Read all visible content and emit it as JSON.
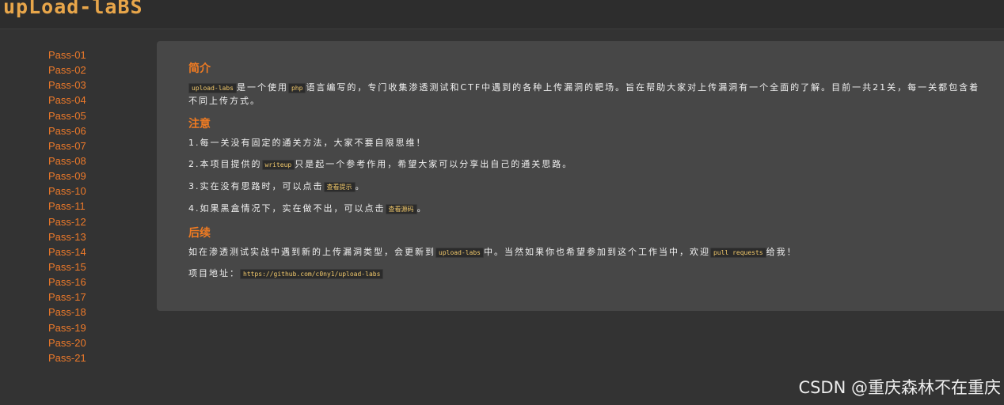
{
  "header": {
    "logo_text": "upLoad-laBS"
  },
  "sidebar": {
    "items": [
      {
        "label": "Pass-01"
      },
      {
        "label": "Pass-02"
      },
      {
        "label": "Pass-03"
      },
      {
        "label": "Pass-04"
      },
      {
        "label": "Pass-05"
      },
      {
        "label": "Pass-06"
      },
      {
        "label": "Pass-07"
      },
      {
        "label": "Pass-08"
      },
      {
        "label": "Pass-09"
      },
      {
        "label": "Pass-10"
      },
      {
        "label": "Pass-11"
      },
      {
        "label": "Pass-12"
      },
      {
        "label": "Pass-13"
      },
      {
        "label": "Pass-14"
      },
      {
        "label": "Pass-15"
      },
      {
        "label": "Pass-16"
      },
      {
        "label": "Pass-17"
      },
      {
        "label": "Pass-18"
      },
      {
        "label": "Pass-19"
      },
      {
        "label": "Pass-20"
      },
      {
        "label": "Pass-21"
      }
    ]
  },
  "intro": {
    "heading": "简介",
    "code_name": "upload-labs",
    "text_a": "是一个使用",
    "code_lang": "php",
    "text_b": "语言编写的，专门收集渗透测试和CTF中遇到的各种上传漏洞的靶场。旨在帮助大家对上传漏洞有一个全面的了解。目前一共21关，每一关都包含着不同上传方式。"
  },
  "notice": {
    "heading": "注意",
    "item1": "1.每一关没有固定的通关方法，大家不要自限思维！",
    "item2_a": "2.本项目提供的",
    "item2_code": "writeup",
    "item2_b": "只是起一个参考作用，希望大家可以分享出自己的通关思路。",
    "item3_a": "3.实在没有思路时，可以点击",
    "item3_code": "查看提示",
    "item3_b": "。",
    "item4_a": "4.如果黑盒情况下，实在做不出，可以点击",
    "item4_code": "查看源码",
    "item4_b": "。"
  },
  "followup": {
    "heading": "后续",
    "text_a": "如在渗透测试实战中遇到新的上传漏洞类型，会更新到",
    "code_name": "upload-labs",
    "text_b": "中。当然如果你也希望参加到这个工作当中，欢迎",
    "code_pr": "pull requests",
    "text_c": "给我！",
    "addr_label": "项目地址：",
    "addr_url": "https://github.com/c0ny1/upload-labs"
  },
  "watermark": "CSDN @重庆森林不在重庆"
}
